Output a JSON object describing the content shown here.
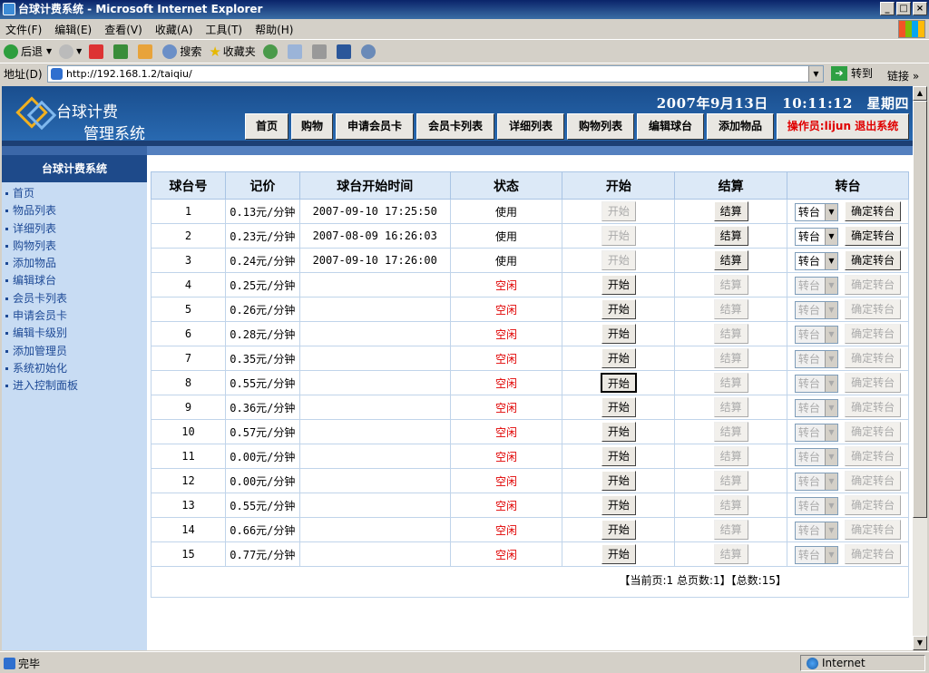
{
  "window": {
    "title": "台球计费系统 - Microsoft Internet Explorer",
    "min": "_",
    "max": "□",
    "close": "×"
  },
  "menu": [
    "文件(F)",
    "编辑(E)",
    "查看(V)",
    "收藏(A)",
    "工具(T)",
    "帮助(H)"
  ],
  "toolbar": {
    "back": "后退",
    "search": "搜索",
    "favorites": "收藏夹"
  },
  "address": {
    "label": "地址(D)",
    "url": "http://192.168.1.2/taiqiu/",
    "go": "转到",
    "links": "链接"
  },
  "header": {
    "title_line1": "台球计费",
    "title_line2": "管理系统",
    "datetime": "2007年9月13日　10:11:12　星期四",
    "nav": [
      "首页",
      "购物",
      "申请会员卡",
      "会员卡列表",
      "详细列表",
      "购物列表",
      "编辑球台",
      "添加物品"
    ],
    "operator": "操作员:lijun 退出系统"
  },
  "sidebar": {
    "title": "台球计费系统",
    "items": [
      "首页",
      "物品列表",
      "详细列表",
      "购物列表",
      "添加物品",
      "编辑球台",
      "会员卡列表",
      "申请会员卡",
      "编辑卡级别",
      "添加管理员",
      "系统初始化",
      "进入控制面板"
    ]
  },
  "table": {
    "columns": [
      "球台号",
      "记价",
      "球台开始时间",
      "状态",
      "开始",
      "结算",
      "转台"
    ],
    "start_label": "开始",
    "settle_label": "结算",
    "transfer_select": "转台",
    "confirm_label": "确定转台",
    "rows": [
      {
        "id": "1",
        "price": "0.13元/分钟",
        "start": "2007-09-10 17:25:50",
        "status": "使用",
        "in_use": true
      },
      {
        "id": "2",
        "price": "0.23元/分钟",
        "start": "2007-08-09 16:26:03",
        "status": "使用",
        "in_use": true
      },
      {
        "id": "3",
        "price": "0.24元/分钟",
        "start": "2007-09-10 17:26:00",
        "status": "使用",
        "in_use": true
      },
      {
        "id": "4",
        "price": "0.25元/分钟",
        "start": "",
        "status": "空闲",
        "in_use": false
      },
      {
        "id": "5",
        "price": "0.26元/分钟",
        "start": "",
        "status": "空闲",
        "in_use": false
      },
      {
        "id": "6",
        "price": "0.28元/分钟",
        "start": "",
        "status": "空闲",
        "in_use": false
      },
      {
        "id": "7",
        "price": "0.35元/分钟",
        "start": "",
        "status": "空闲",
        "in_use": false
      },
      {
        "id": "8",
        "price": "0.55元/分钟",
        "start": "",
        "status": "空闲",
        "in_use": false
      },
      {
        "id": "9",
        "price": "0.36元/分钟",
        "start": "",
        "status": "空闲",
        "in_use": false
      },
      {
        "id": "10",
        "price": "0.57元/分钟",
        "start": "",
        "status": "空闲",
        "in_use": false
      },
      {
        "id": "11",
        "price": "0.00元/分钟",
        "start": "",
        "status": "空闲",
        "in_use": false
      },
      {
        "id": "12",
        "price": "0.00元/分钟",
        "start": "",
        "status": "空闲",
        "in_use": false
      },
      {
        "id": "13",
        "price": "0.55元/分钟",
        "start": "",
        "status": "空闲",
        "in_use": false
      },
      {
        "id": "14",
        "price": "0.66元/分钟",
        "start": "",
        "status": "空闲",
        "in_use": false
      },
      {
        "id": "15",
        "price": "0.77元/分钟",
        "start": "",
        "status": "空闲",
        "in_use": false
      }
    ]
  },
  "pager": "【当前页:1 总页数:1】【总数:15】",
  "status": {
    "done": "完毕",
    "zone": "Internet"
  },
  "colors": {
    "header": "#1a4e8e",
    "sidebar": "#c8dcf3",
    "idle": "#e00000"
  }
}
